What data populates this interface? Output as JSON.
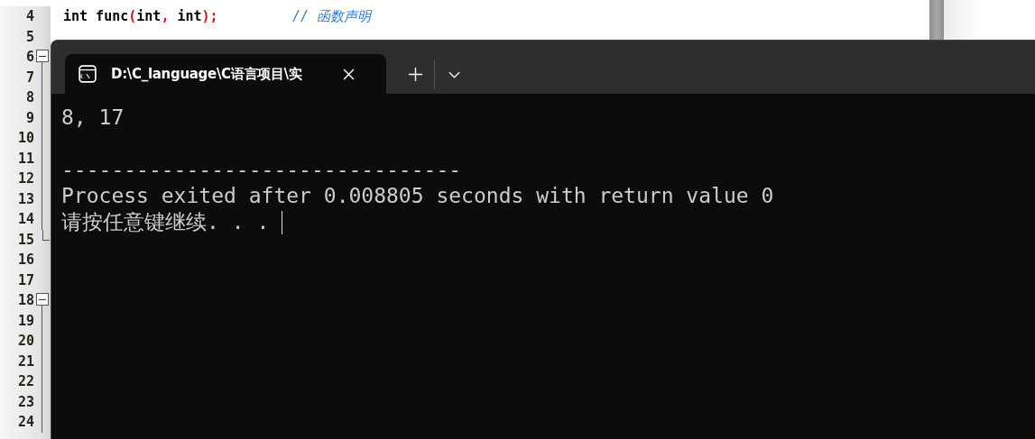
{
  "editor": {
    "lines": [
      {
        "number": "4",
        "kind": "plain",
        "tokens": [
          {
            "kind": "code",
            "text": "int func"
          },
          {
            "kind": "punct",
            "text": "("
          },
          {
            "kind": "code",
            "text": "int"
          },
          {
            "kind": "punct",
            "text": ","
          },
          {
            "kind": "code",
            "text": " int"
          },
          {
            "kind": "punct",
            "text": ");"
          },
          {
            "kind": "comment",
            "text": "// 函数声明"
          }
        ]
      },
      {
        "number": "5",
        "kind": "plain"
      },
      {
        "number": "6",
        "kind": "foldstart"
      },
      {
        "number": "7",
        "kind": "foldline"
      },
      {
        "number": "8",
        "kind": "foldline"
      },
      {
        "number": "9",
        "kind": "foldline"
      },
      {
        "number": "10",
        "kind": "foldline"
      },
      {
        "number": "11",
        "kind": "foldline"
      },
      {
        "number": "12",
        "kind": "foldline"
      },
      {
        "number": "13",
        "kind": "foldline"
      },
      {
        "number": "14",
        "kind": "foldline"
      },
      {
        "number": "15",
        "kind": "foldend"
      },
      {
        "number": "16",
        "kind": "plain"
      },
      {
        "number": "17",
        "kind": "plain"
      },
      {
        "number": "18",
        "kind": "foldstart"
      },
      {
        "number": "19",
        "kind": "foldline"
      },
      {
        "number": "20",
        "kind": "foldline"
      },
      {
        "number": "21",
        "kind": "foldline"
      },
      {
        "number": "22",
        "kind": "foldline"
      },
      {
        "number": "23",
        "kind": "foldline"
      },
      {
        "number": "24",
        "kind": "foldline"
      }
    ]
  },
  "terminal": {
    "tab": {
      "title": "D:\\C_language\\C语言项目\\实",
      "selected": true
    },
    "output": [
      {
        "kind": "text",
        "text": "8, 17"
      },
      {
        "kind": "blank"
      },
      {
        "kind": "text",
        "text": "--------------------------------"
      },
      {
        "kind": "text",
        "text": "Process exited after 0.008805 seconds with return value 0"
      },
      {
        "kind": "text",
        "text": "请按任意键继续. . ."
      }
    ],
    "cursor": true
  }
}
